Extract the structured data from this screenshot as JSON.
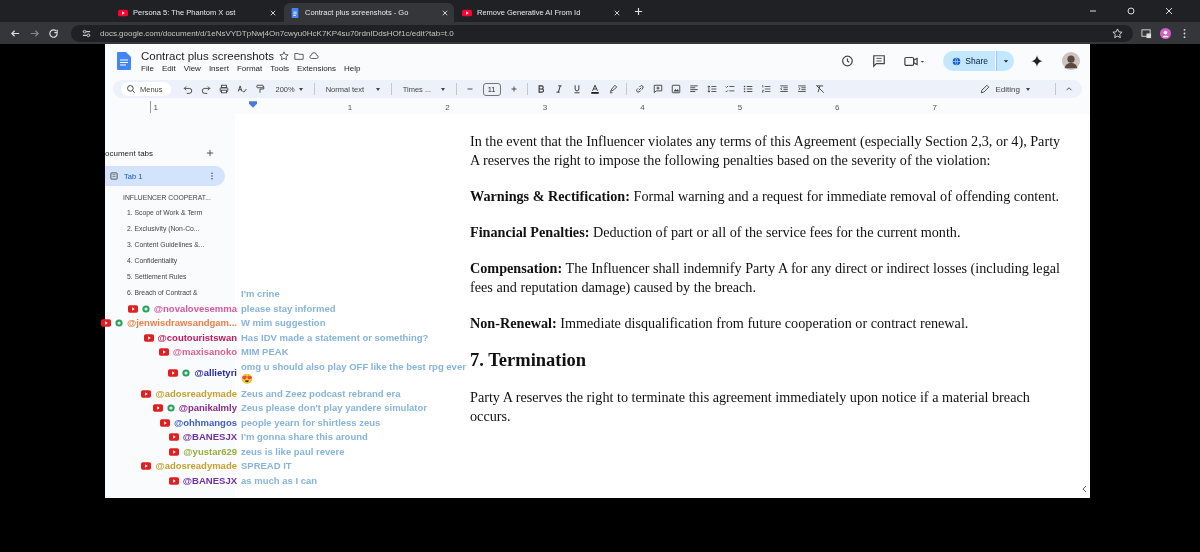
{
  "browser": {
    "tabs": [
      {
        "title": "Persona 5: The Phantom X ost",
        "selected": false,
        "kind": "video"
      },
      {
        "title": "Contract plus screenshots - Go",
        "selected": true,
        "kind": "doc"
      },
      {
        "title": "Remove Generative AI From Id",
        "selected": false,
        "kind": "video"
      }
    ],
    "url": "docs.google.com/document/d/1eNsVYDTpNwj4On7cwyu0HcK7KP4su70rdnIDdsHOf1c/edit?tab=t.0"
  },
  "document": {
    "title": "Contract plus screenshots",
    "menu": [
      "File",
      "Edit",
      "View",
      "Insert",
      "Format",
      "Tools",
      "Extensions",
      "Help"
    ],
    "share_label": "Share",
    "toolbar": {
      "search_label": "Menus",
      "zoom": "200%",
      "style": "Normal text",
      "font": "Times ...",
      "font_size": "11",
      "mode": "Editing"
    },
    "ruler": [
      "1",
      "1",
      "2",
      "3",
      "4",
      "5",
      "6",
      "7"
    ]
  },
  "sidebar": {
    "heading": "ocument tabs",
    "tabs": [
      {
        "label": "Tab 1",
        "selected": true
      }
    ],
    "outline": {
      "title": "INFLUENCER COOPERAT...",
      "children": [
        {
          "label": "1. Scope of Work & Term"
        },
        {
          "label": "2. Exclusivity (Non-Co..."
        },
        {
          "label": "3. Content Guidelines &..."
        },
        {
          "label": "4. Confidentiality"
        },
        {
          "label": "5. Settlement Rules"
        },
        {
          "label": "6. Breach of Contract &"
        }
      ]
    }
  },
  "body": [
    {
      "kind": "para",
      "text": "In the event that the Influencer violates any terms of this Agreement (especially Section 2,3, or 4), Party A reserves the right to impose the following penalties based on the severity of the violation:"
    },
    {
      "kind": "para",
      "text": "**Warnings & Rectification:** Formal warning and a request for immediate removal of offending content."
    },
    {
      "kind": "para",
      "text": "**Financial Penalties:** Deduction of part or all of the service fees for the current month."
    },
    {
      "kind": "para",
      "text": "**Compensation:** The Influencer shall indemnify Party A for any direct or indirect losses (including legal fees and reputation damage) caused by the breach."
    },
    {
      "kind": "para",
      "text": "**Non-Renewal:** Immediate disqualification from future cooperation or contract renewal."
    },
    {
      "kind": "heading",
      "text": "7. Termination"
    },
    {
      "kind": "para",
      "text": "Party A reserves the right to terminate this agreement immediately upon notice if a material breach occurs."
    }
  ],
  "chat": [
    {
      "message": "I'm crine"
    },
    {
      "name": "@novalovesemma",
      "color": "#d9579a",
      "member": true,
      "message": "please stay informed"
    },
    {
      "name": "@jenwisdrawsandgam...",
      "color": "#e8804a",
      "member": true,
      "message": "W mim suggestion"
    },
    {
      "name": "@coutouristswan",
      "color": "#c2185b",
      "member": false,
      "message": "Has IDV made a statement or something?"
    },
    {
      "name": "@maxisanoko",
      "color": "#e06090",
      "member": false,
      "message": "MIM PEAK"
    },
    {
      "name": "@allietyri",
      "color": "#2a2aa8",
      "member": true,
      "message": "omg u should also play OFF like the best rpg ever 😍"
    },
    {
      "name": "@adosreadymade",
      "color": "#c8a030",
      "member": false,
      "message": "Zeus and Zeez podcast rebrand era"
    },
    {
      "name": "@panikalmly",
      "color": "#8b2a8b",
      "member": true,
      "message": "Zeus please don't play yandere simulator"
    },
    {
      "name": "@ohhmangos",
      "color": "#4060c0",
      "member": false,
      "message": "people yearn for shirtless zeus"
    },
    {
      "name": "@BANESJX",
      "color": "#7030a0",
      "member": false,
      "message": "I'm gonna share this around"
    },
    {
      "name": "@yustar629",
      "color": "#9aab40",
      "member": false,
      "message": "zeus is like paul revere"
    },
    {
      "name": "@adosreadymade",
      "color": "#c8a030",
      "member": false,
      "message": "SPREAD IT"
    },
    {
      "name": "@BANESJX",
      "color": "#7030a0",
      "member": false,
      "message": "as much as I can"
    }
  ]
}
